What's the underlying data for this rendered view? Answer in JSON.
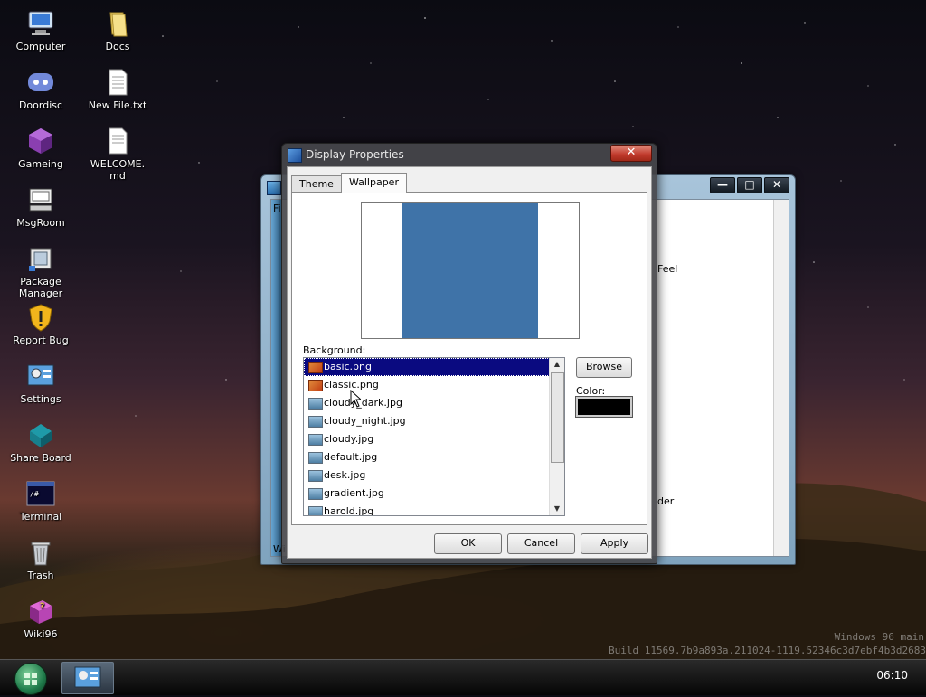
{
  "desktop": {
    "icons": [
      {
        "label": "Computer"
      },
      {
        "label": "Docs"
      },
      {
        "label": "Doordisc"
      },
      {
        "label": "New File.txt"
      },
      {
        "label": "Gameing"
      },
      {
        "label": "WELCOME.\nmd"
      },
      {
        "label": "MsgRoom"
      },
      {
        "label": "Package\nManager"
      },
      {
        "label": "Report Bug"
      },
      {
        "label": "Settings"
      },
      {
        "label": "Share Board"
      },
      {
        "label": "Terminal"
      },
      {
        "label": "Trash"
      },
      {
        "label": "Wiki96"
      }
    ]
  },
  "background_window": {
    "menu_first_letter": "Fi",
    "text_1": "Feel",
    "text_2": "der",
    "bottom_left": "Wi"
  },
  "dialog": {
    "title": "Display Properties",
    "close_label": "✕",
    "tabs": [
      {
        "label": "Theme"
      },
      {
        "label": "Wallpaper"
      }
    ],
    "active_tab": "Wallpaper",
    "preview_color": "#3f73a8",
    "background_label": "Background:",
    "backgrounds": [
      {
        "name": "basic.png",
        "kind": "png",
        "selected": true
      },
      {
        "name": "classic.png",
        "kind": "png",
        "selected": false
      },
      {
        "name": "cloudy_dark.jpg",
        "kind": "jpg",
        "selected": false
      },
      {
        "name": "cloudy_night.jpg",
        "kind": "jpg",
        "selected": false
      },
      {
        "name": "cloudy.jpg",
        "kind": "jpg",
        "selected": false
      },
      {
        "name": "default.jpg",
        "kind": "jpg",
        "selected": false
      },
      {
        "name": "desk.jpg",
        "kind": "jpg",
        "selected": false
      },
      {
        "name": "gradient.jpg",
        "kind": "jpg",
        "selected": false
      },
      {
        "name": "harold.jpg",
        "kind": "jpg",
        "selected": false
      }
    ],
    "browse_label": "Browse",
    "color_label": "Color:",
    "color_value": "#000000",
    "ok_label": "OK",
    "cancel_label": "Cancel",
    "apply_label": "Apply"
  },
  "watermark": {
    "line1": "Windows 96 main",
    "line2": "Build 11569.7b9a893a.211024-1119.52346c3d7ebf4b3d2683"
  },
  "taskbar": {
    "clock": "06:10"
  }
}
